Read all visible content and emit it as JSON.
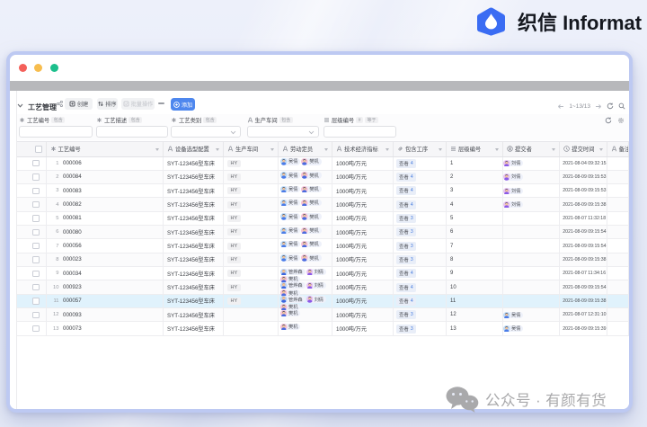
{
  "brand": {
    "logo_text": "织信 Informat",
    "logo_color": "#3a6cf3"
  },
  "window": {
    "traffic_lights": [
      "#f4605a",
      "#f7bd4e",
      "#1cbf8c"
    ]
  },
  "toolbar": {
    "view_title": "工艺管理",
    "create_label": "创建",
    "sort_label": "排序",
    "batch_label": "批量操作",
    "add_label": "添加",
    "add_color": "#4e87ee",
    "pagination": "1~13/13"
  },
  "filters": {
    "fields": [
      {
        "icon": "asterisk-icon",
        "label": "工艺编号",
        "ops": [
          "包含"
        ],
        "type": "text"
      },
      {
        "icon": "asterisk-icon",
        "label": "工艺描述",
        "ops": [
          "包含"
        ],
        "type": "text"
      },
      {
        "icon": "asterisk-icon",
        "label": "工艺类别",
        "ops": [
          "包含"
        ],
        "type": "select"
      },
      {
        "icon": "text-field-icon",
        "label": "生产车间",
        "ops": [
          "包含"
        ],
        "type": "select"
      },
      {
        "icon": "list-icon",
        "label": "层级编号",
        "ops": [
          "#",
          "等于"
        ],
        "type": "text"
      }
    ]
  },
  "table": {
    "columns": [
      {
        "icon": "checkbox-icon",
        "label": ""
      },
      {
        "icon": "asterisk-icon",
        "label": "工艺编号"
      },
      {
        "icon": "text-field-icon",
        "label": "设备选型配置"
      },
      {
        "icon": "text-field-icon",
        "label": "生产车间"
      },
      {
        "icon": "text-field-icon",
        "label": "劳动定员"
      },
      {
        "icon": "text-field-icon",
        "label": "技术经济指标"
      },
      {
        "icon": "link-icon",
        "label": "包含工序"
      },
      {
        "icon": "list-icon",
        "label": "层级编号"
      },
      {
        "icon": "person-icon",
        "label": "提交者"
      },
      {
        "icon": "clock-icon",
        "label": "提交时间"
      },
      {
        "icon": "text-field-icon",
        "label": "备注"
      }
    ],
    "view_label": "查看",
    "people": {
      "wuqian": {
        "name": "吴倩",
        "bg": "#bfdcf8",
        "hair": "#3c4457",
        "skin": "#f2c49c",
        "shirt": "#4a7ce8"
      },
      "fanji": {
        "name": "樊机",
        "bg": "#f6c2d6",
        "hair": "#333a48",
        "skin": "#f2c49c",
        "shirt": "#4a6ae0"
      },
      "guan": {
        "name": "管烨森",
        "bg": "#bcd4f8",
        "hair": "#e09a58",
        "skin": "#f2c49c",
        "shirt": "#3a66e0"
      },
      "liuqian": {
        "name": "刘倩",
        "bg": "#e8c2f0",
        "hair": "#4a3a66",
        "skin": "#f2c49c",
        "shirt": "#8a5ae8"
      }
    },
    "rows": [
      {
        "num": 1,
        "code": "000006",
        "device": "SYT-123456型车床",
        "workshop": "HY",
        "staff": [
          "wuqian",
          "fanji"
        ],
        "indicator": "1000吨/万元",
        "view_count": 4,
        "level": 1,
        "submitter": "liuqian",
        "time": "2021-08-04 09:32:15"
      },
      {
        "num": 2,
        "code": "000084",
        "device": "SYT-123456型车床",
        "workshop": "HY",
        "staff": [
          "wuqian",
          "fanji"
        ],
        "indicator": "1000吨/万元",
        "view_count": 4,
        "level": 2,
        "submitter": "liuqian",
        "time": "2021-08-09 09:15:53"
      },
      {
        "num": 3,
        "code": "000083",
        "device": "SYT-123456型车床",
        "workshop": "HY",
        "staff": [
          "wuqian",
          "fanji"
        ],
        "indicator": "1000吨/万元",
        "view_count": 4,
        "level": 3,
        "submitter": "liuqian",
        "time": "2021-08-09 09:15:53"
      },
      {
        "num": 4,
        "code": "000082",
        "device": "SYT-123456型车床",
        "workshop": "HY",
        "staff": [
          "wuqian",
          "fanji"
        ],
        "indicator": "1000吨/万元",
        "view_count": 4,
        "level": 4,
        "submitter": "liuqian",
        "time": "2021-08-09 09:15:38"
      },
      {
        "num": 5,
        "code": "000081",
        "device": "SYT-123456型车床",
        "workshop": "HY",
        "staff": [
          "wuqian",
          "fanji"
        ],
        "indicator": "1000吨/万元",
        "view_count": 3,
        "level": 5,
        "submitter": null,
        "time": "2021-08-07 11:32:18"
      },
      {
        "num": 6,
        "code": "000080",
        "device": "SYT-123456型车床",
        "workshop": "HY",
        "staff": [
          "wuqian",
          "fanji"
        ],
        "indicator": "1000吨/万元",
        "view_count": 3,
        "level": 6,
        "submitter": null,
        "time": "2021-08-09 09:15:54"
      },
      {
        "num": 7,
        "code": "000056",
        "device": "SYT-123456型车床",
        "workshop": "HY",
        "staff": [
          "wuqian",
          "fanji"
        ],
        "indicator": "1000吨/万元",
        "view_count": 3,
        "level": 7,
        "submitter": null,
        "time": "2021-08-09 09:15:54"
      },
      {
        "num": 8,
        "code": "000023",
        "device": "SYT-123456型车床",
        "workshop": "HY",
        "staff": [
          "wuqian",
          "fanji"
        ],
        "indicator": "1000吨/万元",
        "view_count": 3,
        "level": 8,
        "submitter": null,
        "time": "2021-08-09 09:15:38"
      },
      {
        "num": 9,
        "code": "000034",
        "device": "SYT-123456型车床",
        "workshop": "HY",
        "staff": [
          "guan",
          "liuqian",
          "fanji"
        ],
        "indicator": "1000吨/万元",
        "view_count": 4,
        "level": 9,
        "submitter": null,
        "time": "2021-08-07 11:34:16"
      },
      {
        "num": 10,
        "code": "000923",
        "device": "SYT-123456型车床",
        "workshop": "HY",
        "staff": [
          "guan",
          "liuqian",
          "fanji"
        ],
        "indicator": "1000吨/万元",
        "view_count": 4,
        "level": 10,
        "submitter": null,
        "time": "2021-08-09 09:15:54"
      },
      {
        "num": 11,
        "code": "000057",
        "device": "SYT-123456型车床",
        "workshop": "HY",
        "staff": [
          "guan",
          "liuqian",
          "fanji"
        ],
        "indicator": "1000吨/万元",
        "view_count": 4,
        "level": 11,
        "submitter": null,
        "time": "2021-08-09 09:15:38",
        "highlighted": true
      },
      {
        "num": 12,
        "code": "000093",
        "device": "SYT-123456型车床",
        "workshop": "",
        "staff": [
          "fanji"
        ],
        "indicator": "1000吨/万元",
        "view_count": 3,
        "level": 12,
        "submitter": "wuqian",
        "time": "2021-08-07 12:31:10"
      },
      {
        "num": 13,
        "code": "000073",
        "device": "SYT-123456型车床",
        "workshop": "",
        "staff": [
          "fanji"
        ],
        "indicator": "1000吨/万元",
        "view_count": 3,
        "level": 13,
        "submitter": "wuqian",
        "time": "2021-08-09 09:15:39"
      }
    ]
  },
  "watermark": {
    "text": "公众号 · 有颜有货"
  }
}
